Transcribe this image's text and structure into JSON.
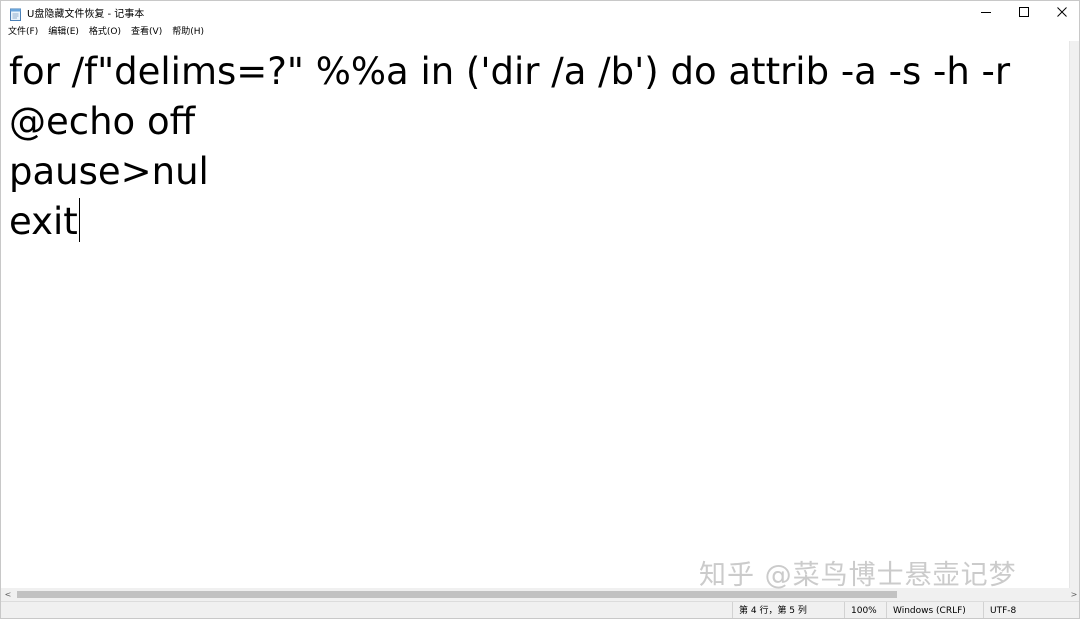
{
  "window": {
    "title": "U盘隐藏文件恢复 - 记事本",
    "controls": {
      "minimize": "—",
      "maximize": "☐",
      "close": "✕"
    }
  },
  "menu": {
    "items": [
      "文件(F)",
      "编辑(E)",
      "格式(O)",
      "查看(V)",
      "帮助(H)"
    ]
  },
  "editor": {
    "lines": [
      "for /f\"delims=?\" %%a in ('dir /a /b') do attrib -a -s -h -r",
      "@echo off",
      "pause>nul",
      "exit"
    ]
  },
  "scrollbar": {
    "left_arrow": "<",
    "right_arrow": ">"
  },
  "status": {
    "position": "第 4 行，第 5 列",
    "zoom": "100%",
    "line_ending": "Windows (CRLF)",
    "encoding": "UTF-8"
  },
  "watermark": "知乎 @菜鸟博士悬壶记梦"
}
